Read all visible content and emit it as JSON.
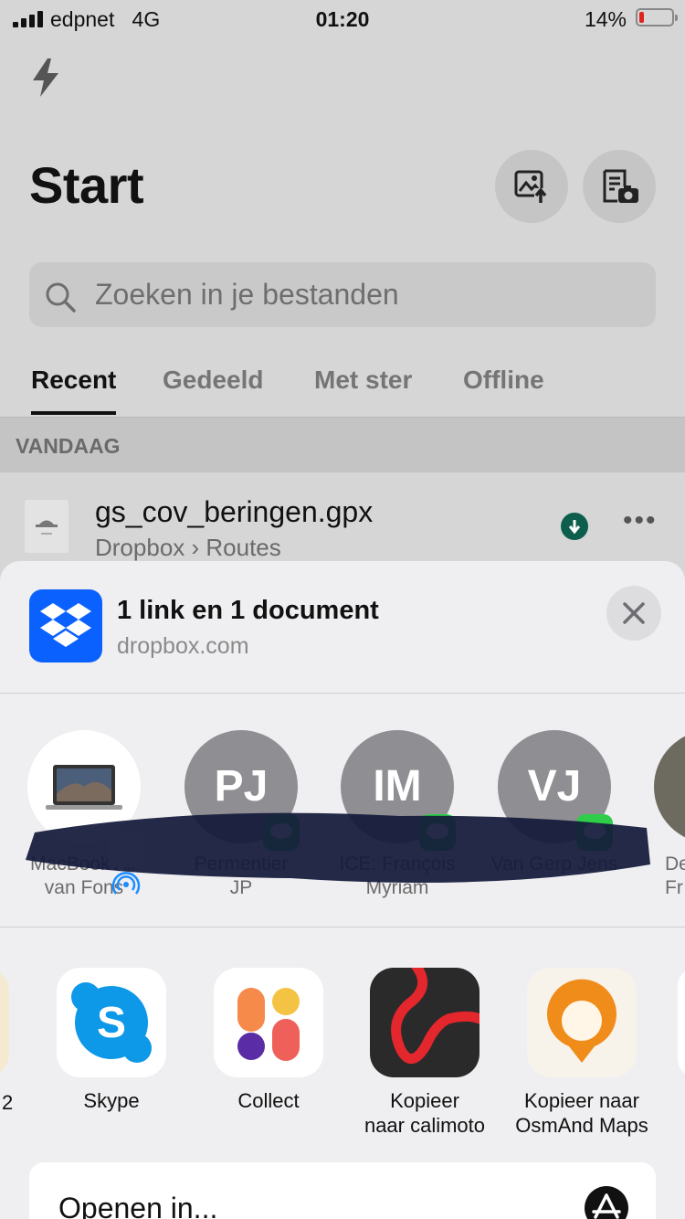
{
  "status_bar": {
    "carrier": "edpnet",
    "network": "4G",
    "time": "01:20",
    "battery_percent": "14%",
    "battery_level": 0.14,
    "battery_color": "#e0241b"
  },
  "header": {
    "title": "Start",
    "bolt_icon": "lightning-bolt-icon",
    "upload_photo_icon": "photo-upload-icon",
    "scan_document_icon": "document-scan-icon"
  },
  "search": {
    "placeholder": "Zoeken in je bestanden",
    "icon": "search-icon"
  },
  "tabs": [
    {
      "label": "Recent",
      "active": true
    },
    {
      "label": "Gedeeld",
      "active": false
    },
    {
      "label": "Met ster",
      "active": false
    },
    {
      "label": "Offline",
      "active": false
    }
  ],
  "section": {
    "label": "VANDAAG"
  },
  "file": {
    "name": "gs_cov_beringen.gpx",
    "path": "Dropbox › Routes",
    "icon": "gpx-file-icon",
    "status_icon": "offline-download-icon",
    "status_color": "#0d5e4c",
    "more_icon": "more-icon"
  },
  "share_sheet": {
    "title": "1 link en 1 document",
    "subtitle": "dropbox.com",
    "app_icon": "dropbox-icon",
    "brand_color": "#0b61fe",
    "close_icon": "close-icon",
    "people": [
      {
        "initials": "",
        "line1": "MacBook Air",
        "line2": "van Fons",
        "badge": "airdrop-icon"
      },
      {
        "initials": "PJ",
        "line1": "Permentier",
        "line2": "JP",
        "badge": "messages-icon"
      },
      {
        "initials": "IM",
        "line1": "ICE: François",
        "line2": "Myriam",
        "badge": "messages-icon"
      },
      {
        "initials": "VJ",
        "line1": "Van Gerp Jens",
        "line2": "",
        "badge": "messages-icon"
      },
      {
        "initials": "",
        "line1": "De",
        "line2": "Fr",
        "badge": ""
      }
    ],
    "apps": [
      {
        "label_line1": "Skype",
        "label_line2": "",
        "icon": "skype-icon"
      },
      {
        "label_line1": "Collect",
        "label_line2": "",
        "icon": "collect-icon"
      },
      {
        "label_line1": "Kopieer",
        "label_line2": "naar calimoto",
        "icon": "calimoto-icon"
      },
      {
        "label_line1": "Kopieer naar",
        "label_line2": "OsmAnd Maps",
        "icon": "osmand-icon"
      }
    ],
    "edge_app_label": "2",
    "open_in": {
      "label": "Openen in...",
      "icon": "app-store-icon"
    }
  }
}
